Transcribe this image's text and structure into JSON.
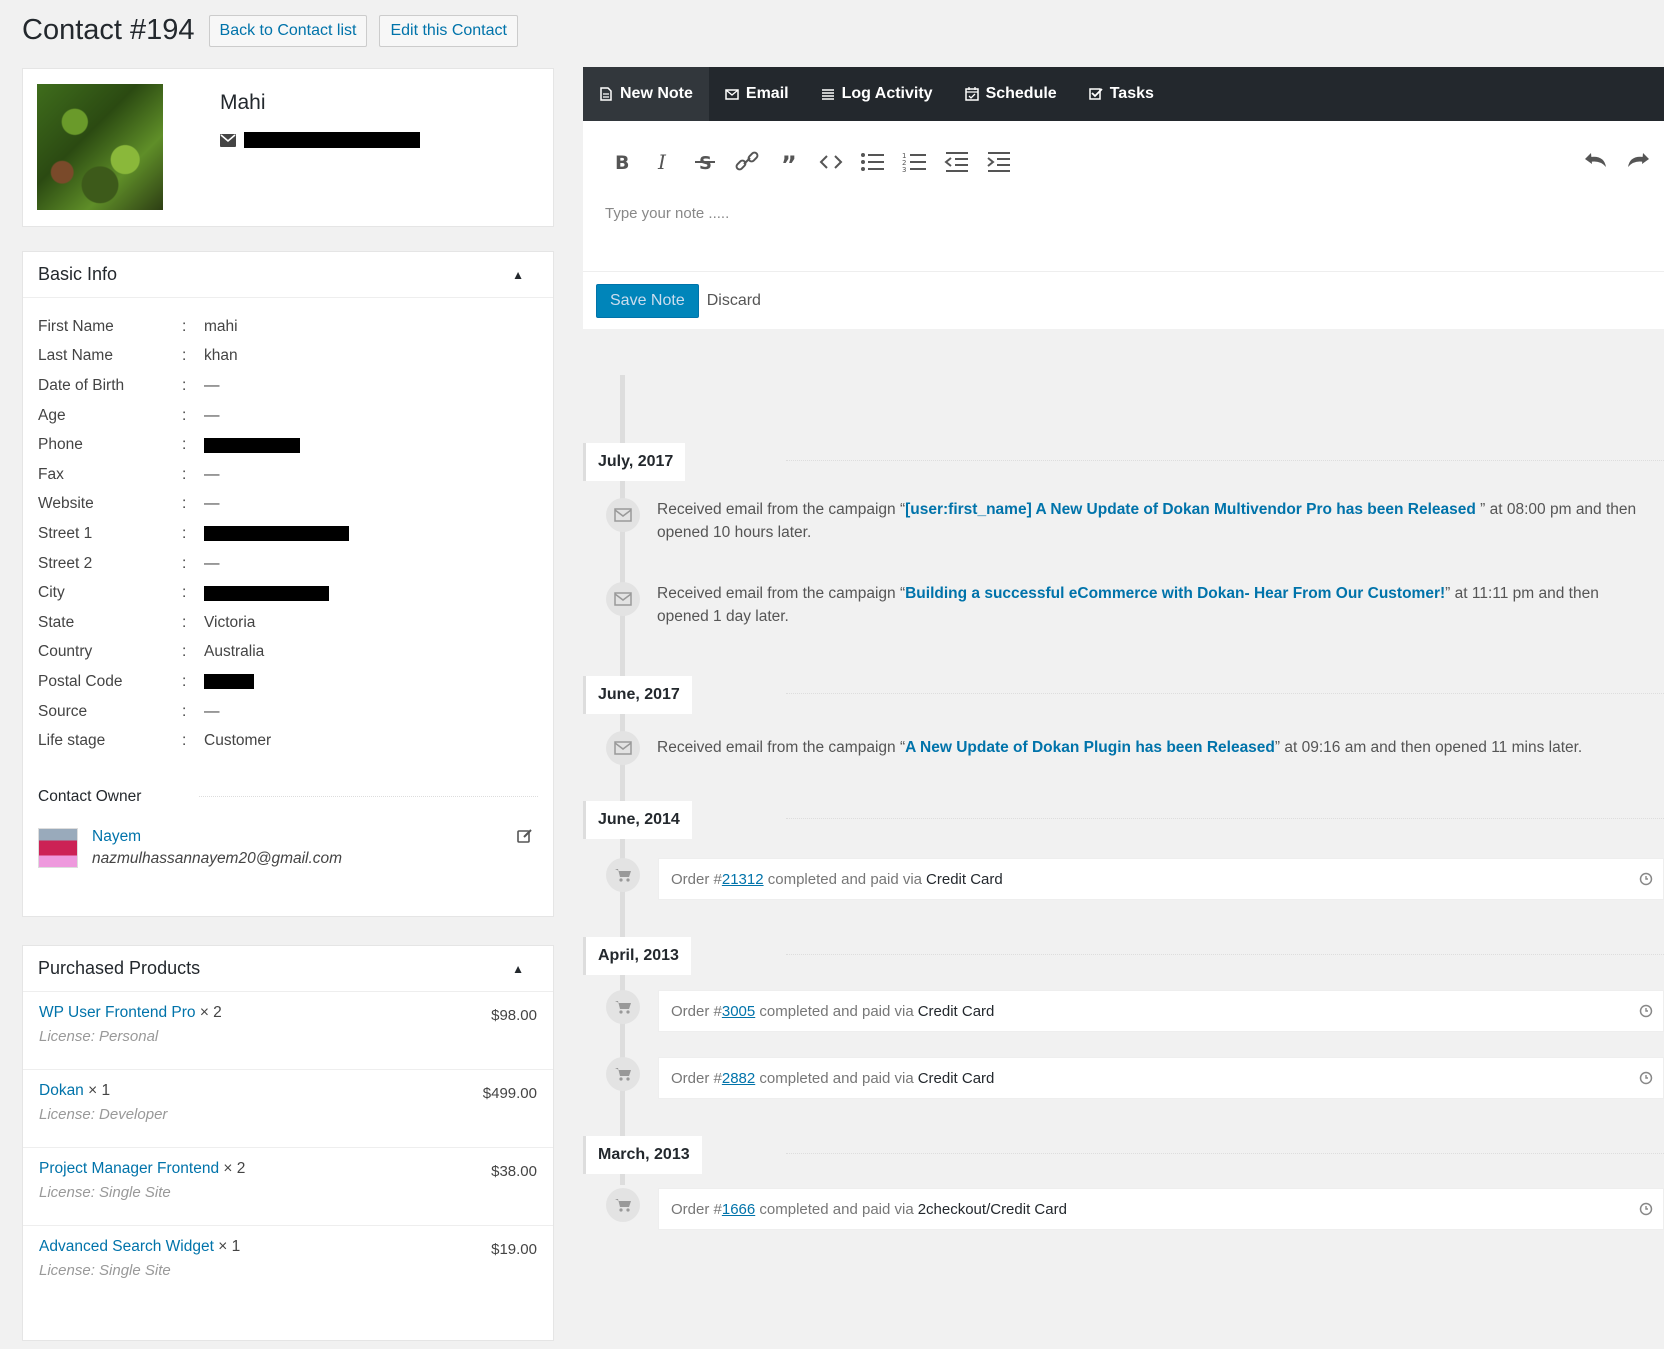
{
  "header": {
    "title": "Contact #194",
    "back_label": "Back to Contact list",
    "edit_label": "Edit this Contact"
  },
  "profile": {
    "name": "Mahi"
  },
  "basic_info": {
    "title": "Basic Info",
    "rows": [
      {
        "label": "First Name",
        "value": "mahi"
      },
      {
        "label": "Last Name",
        "value": "khan"
      },
      {
        "label": "Date of Birth",
        "value": "—"
      },
      {
        "label": "Age",
        "value": "—"
      },
      {
        "label": "Phone",
        "value": ""
      },
      {
        "label": "Fax",
        "value": "—"
      },
      {
        "label": "Website",
        "value": "—"
      },
      {
        "label": "Street 1",
        "value": ""
      },
      {
        "label": "Street 2",
        "value": "—"
      },
      {
        "label": "City",
        "value": ""
      },
      {
        "label": "State",
        "value": "Victoria"
      },
      {
        "label": "Country",
        "value": "Australia"
      },
      {
        "label": "Postal Code",
        "value": ""
      },
      {
        "label": "Source",
        "value": "—"
      },
      {
        "label": "Life stage",
        "value": "Customer"
      }
    ],
    "owner_title": "Contact Owner",
    "owner_name": "Nayem",
    "owner_email": "nazmulhassannayem20@gmail.com"
  },
  "products": {
    "title": "Purchased Products",
    "items": [
      {
        "name": "WP User Frontend Pro",
        "qty": "× 2",
        "license": "License: Personal",
        "price": "$98.00"
      },
      {
        "name": "Dokan",
        "qty": "× 1",
        "license": "License: Developer",
        "price": "$499.00"
      },
      {
        "name": "Project Manager Frontend",
        "qty": "× 2",
        "license": "License: Single Site",
        "price": "$38.00"
      },
      {
        "name": "Advanced Search Widget",
        "qty": "× 1",
        "license": "License: Single Site",
        "price": "$19.00"
      }
    ]
  },
  "tabs": [
    "New Note",
    "Email",
    "Log Activity",
    "Schedule",
    "Tasks"
  ],
  "editor": {
    "placeholder": "Type your note .....",
    "save_label": "Save Note",
    "discard_label": "Discard"
  },
  "timeline": {
    "months": [
      "July, 2017",
      "June, 2017",
      "June, 2014",
      "April, 2013",
      "March, 2013"
    ],
    "emails": [
      {
        "pre": "Received email from the campaign “",
        "campaign": "[user:first_name] A New Update of Dokan Multivendor Pro has been Released",
        "post": " ” at 08:00 pm and then opened 10 hours later."
      },
      {
        "pre": "Received email from the campaign “",
        "campaign": "Building a successful eCommerce with Dokan- Hear From Our Customer!",
        "post": "” at 11:11 pm and then opened 1 day later."
      },
      {
        "pre": "Received email from the campaign “",
        "campaign": "A New Update of Dokan Plugin has been Released",
        "post": "” at 09:16 am and then opened 11 mins later."
      }
    ],
    "orders": [
      {
        "prefix": "Order #",
        "id": "21312",
        "mid": "completed and paid via",
        "via": "Credit Card"
      },
      {
        "prefix": "Order #",
        "id": "3005",
        "mid": "completed and paid via",
        "via": "Credit Card"
      },
      {
        "prefix": "Order #",
        "id": "2882",
        "mid": "completed and paid via",
        "via": "Credit Card"
      },
      {
        "prefix": "Order #",
        "id": "1666",
        "mid": "completed and paid via",
        "via": "2checkout/Credit Card"
      }
    ]
  },
  "icons": {
    "email": "envelope-icon",
    "order": "cart-icon",
    "clock": "clock-icon",
    "edit": "edit-icon"
  },
  "colors": {
    "accent": "#0073aa",
    "tabbar": "#23282d",
    "save": "#0085ba"
  }
}
